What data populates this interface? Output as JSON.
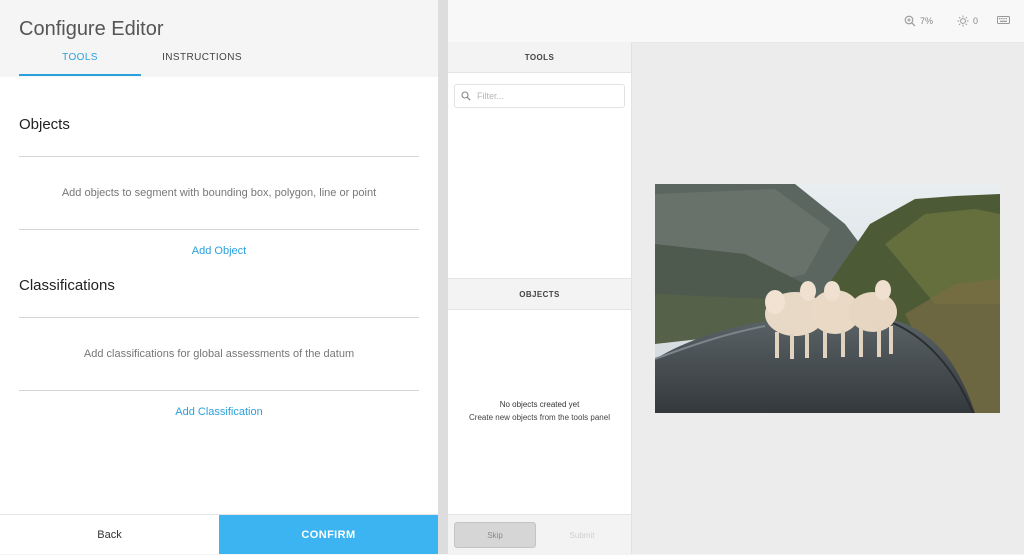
{
  "config": {
    "title": "Configure Editor",
    "tabs": [
      {
        "label": "TOOLS",
        "active": true
      },
      {
        "label": "INSTRUCTIONS",
        "active": false
      }
    ],
    "objects": {
      "title": "Objects",
      "description": "Add objects to segment with bounding box, polygon, line or point",
      "add_label": "Add Object"
    },
    "classifications": {
      "title": "Classifications",
      "description": "Add classifications for global assessments of the datum",
      "add_label": "Add Classification"
    },
    "footer": {
      "back_label": "Back",
      "confirm_label": "CONFIRM"
    }
  },
  "editor": {
    "topbar": {
      "zoom_icon": "zoom-in-icon",
      "zoom_value": "7%",
      "brightness_icon": "brightness-icon",
      "brightness_value": "0",
      "keyboard_icon": "keyboard-icon"
    },
    "tools_panel": {
      "title": "TOOLS",
      "filter_placeholder": "Filter..."
    },
    "objects_panel": {
      "title": "OBJECTS",
      "empty_title": "No objects created yet",
      "empty_subtitle": "Create new objects from the tools panel"
    },
    "footer": {
      "skip_label": "Skip",
      "submit_label": "Submit"
    }
  },
  "colors": {
    "accent": "#2aa0dd",
    "confirm": "#3db4f2"
  }
}
